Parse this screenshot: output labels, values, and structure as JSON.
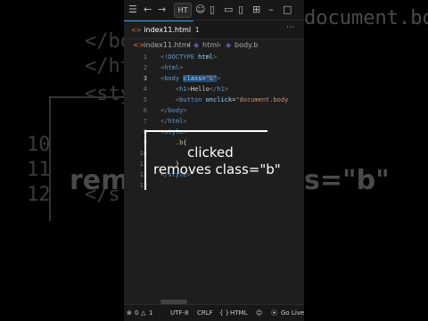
{
  "background": {
    "left_code": [
      "</bo",
      "</ht",
      "<sty",
      "10",
      "11",
      "12"
    ],
    "right_code": "document.body",
    "right_caption": "s=\"b\"",
    "left_caption": "rem"
  },
  "titlebar": {
    "search_box_text": "HT"
  },
  "tab": {
    "filename": "index11.html",
    "dirty_count": "1"
  },
  "breadcrumb": {
    "file": "index11.html",
    "tag": "html",
    "class_selector": "body.b"
  },
  "editor": {
    "line_numbers": [
      "1",
      "2",
      "3",
      "4",
      "5",
      "6",
      "7",
      "8",
      "9",
      "10",
      "11",
      "12",
      "13"
    ],
    "active_line": "3"
  },
  "caption": {
    "line1": "clicked",
    "line2": "removes class=\"b\""
  },
  "statusbar": {
    "problems": "0",
    "warnings": "1",
    "encoding": "UTF-8",
    "eol": "CRLF",
    "language": "HTML",
    "language_icon": "{ }",
    "go_live": "Go Live"
  }
}
